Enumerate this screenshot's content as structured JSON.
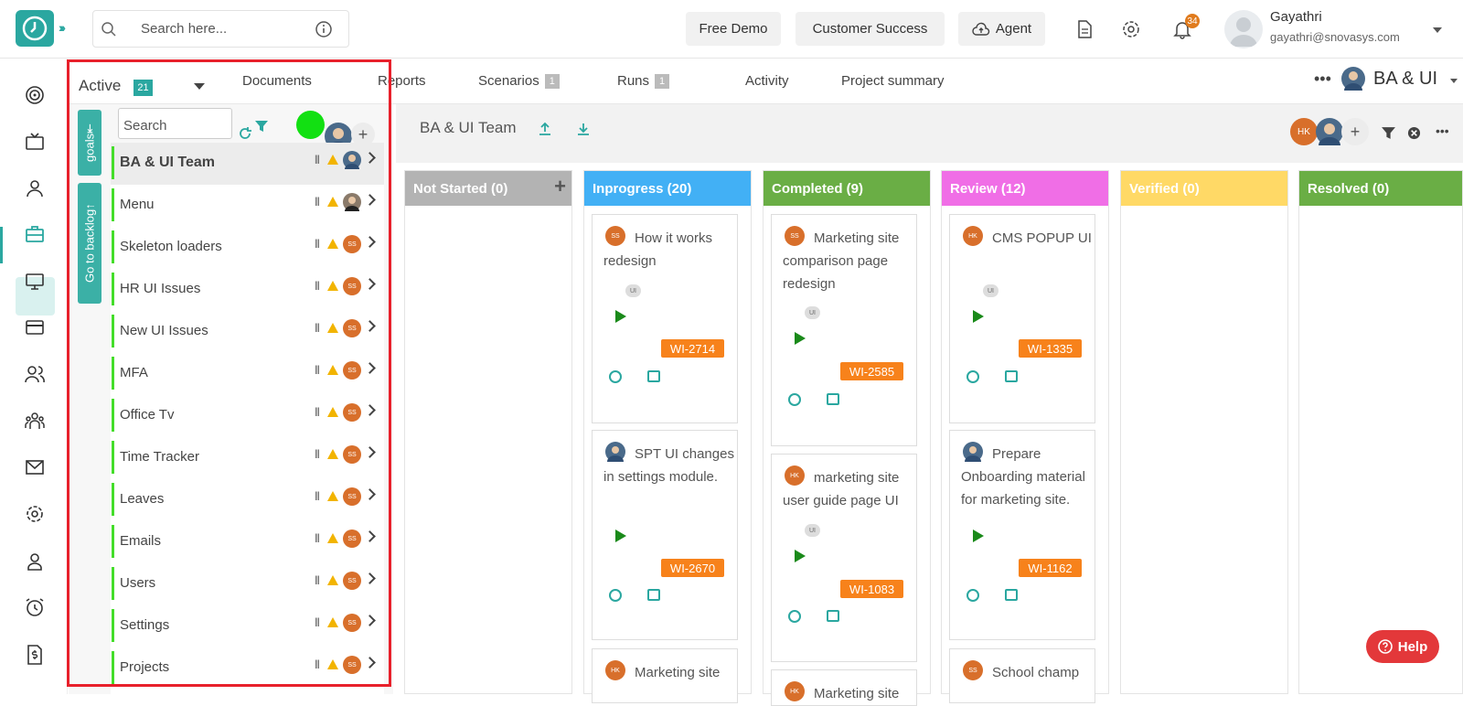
{
  "header": {
    "search_placeholder": "Search here...",
    "buttons": {
      "free_demo": "Free Demo",
      "customer_success": "Customer Success",
      "agent": "Agent"
    },
    "notifications_count": "34",
    "user": {
      "name": "Gayathri",
      "email": "gayathri@snovasys.com"
    }
  },
  "tabs": {
    "active_label": "Active",
    "active_count": "21",
    "documents": "Documents",
    "reports": "Reports",
    "scenarios": "Scenarios",
    "scenarios_count": "1",
    "runs": "Runs",
    "runs_count": "1",
    "activity": "Activity",
    "project_summary": "Project summary",
    "project_name": "BA & UI"
  },
  "goals_panel": {
    "goals_btn": "goals",
    "backlog_btn": "Go to backlog",
    "search_placeholder": "Search",
    "items": [
      {
        "label": "BA & UI Team",
        "avatar": ""
      },
      {
        "label": "Menu",
        "avatar": ""
      },
      {
        "label": "Skeleton loaders",
        "avatar": "SS"
      },
      {
        "label": "HR UI Issues",
        "avatar": "SS"
      },
      {
        "label": "New UI Issues",
        "avatar": "SS"
      },
      {
        "label": "MFA",
        "avatar": "SS"
      },
      {
        "label": "Office Tv",
        "avatar": "SS"
      },
      {
        "label": "Time Tracker",
        "avatar": "SS"
      },
      {
        "label": "Leaves",
        "avatar": "SS"
      },
      {
        "label": "Emails",
        "avatar": "SS"
      },
      {
        "label": "Users",
        "avatar": "SS"
      },
      {
        "label": "Settings",
        "avatar": "SS"
      },
      {
        "label": "Projects",
        "avatar": "SS"
      }
    ]
  },
  "board": {
    "title": "BA & UI Team",
    "member_initials": "HK",
    "columns": [
      {
        "name": "Not Started (0)",
        "color": "#b3b3b3"
      },
      {
        "name": "Inprogress (20)",
        "color": "#42b0f5"
      },
      {
        "name": "Completed (9)",
        "color": "#6aae45"
      },
      {
        "name": "Review (12)",
        "color": "#f06ee6"
      },
      {
        "name": "Verified (0)",
        "color": "#ffd966"
      },
      {
        "name": "Resolved (0)",
        "color": "#6aae45"
      }
    ],
    "cards": {
      "c1": {
        "avatar": "SS",
        "title": "How it works redesign",
        "tag": "UI",
        "wi": "WI-2714"
      },
      "c2": {
        "avatar": "",
        "title": "SPT UI changes in settings module.",
        "wi": "WI-2670"
      },
      "c3": {
        "avatar": "HK",
        "title": "Marketing site"
      },
      "c4": {
        "avatar": "SS",
        "title": "Marketing site comparison page redesign",
        "tag": "UI",
        "wi": "WI-2585"
      },
      "c5": {
        "avatar": "HK",
        "title": "marketing site user guide page UI",
        "tag": "UI",
        "wi": "WI-1083"
      },
      "c6": {
        "avatar": "HK",
        "title": "Marketing site"
      },
      "c7": {
        "avatar": "HK",
        "title": "CMS POPUP UI",
        "tag": "UI",
        "wi": "WI-1335"
      },
      "c8": {
        "avatar": "",
        "title": "Prepare Onboarding material for marketing site.",
        "wi": "WI-1162"
      },
      "c9": {
        "avatar": "SS",
        "title": "School champ"
      }
    }
  },
  "help_label": "Help"
}
